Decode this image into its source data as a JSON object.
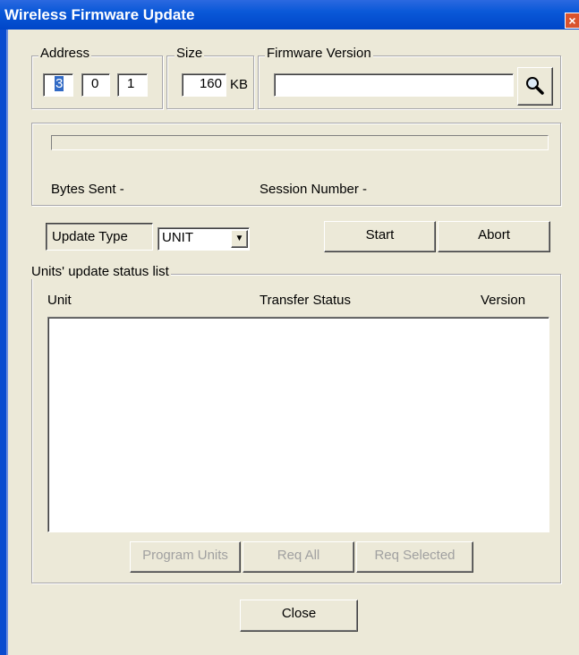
{
  "window": {
    "title": "Wireless Firmware Update",
    "close_glyph": "×"
  },
  "address": {
    "legend": "Address",
    "octet1": "3",
    "octet2": "0",
    "octet3": "1"
  },
  "size": {
    "legend": "Size",
    "value": "160",
    "unit": "KB"
  },
  "firmware": {
    "legend": "Firmware Version",
    "value": "",
    "browse_icon": "magnifier-icon"
  },
  "progress": {
    "value": 0,
    "bytes_sent_label": "Bytes Sent -",
    "session_label": "Session Number -"
  },
  "update_type": {
    "label": "Update Type",
    "selected": "UNIT"
  },
  "actions": {
    "start": "Start",
    "abort": "Abort"
  },
  "units": {
    "legend": "Units' update status list",
    "columns": [
      "Unit",
      "Transfer Status",
      "Version"
    ],
    "rows": [],
    "program_units": "Program Units",
    "req_all": "Req All",
    "req_selected": "Req Selected"
  },
  "close_button": "Close"
}
